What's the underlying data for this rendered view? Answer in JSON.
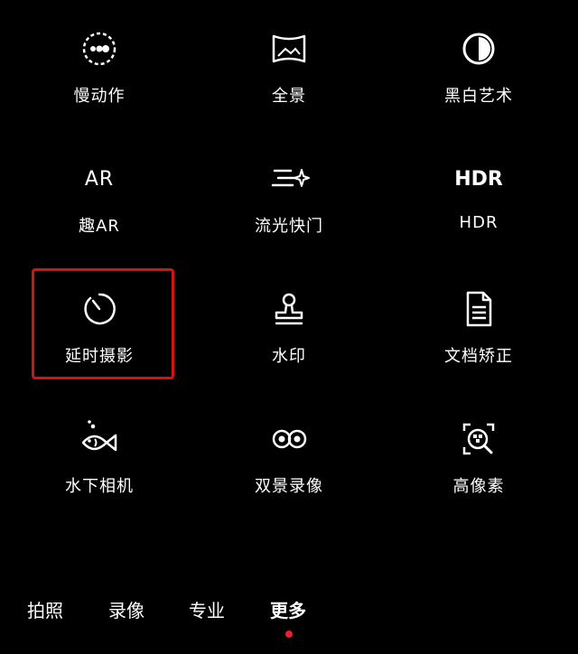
{
  "modes": [
    {
      "id": "slow-motion",
      "label": "慢动作",
      "icon": "slow-motion-icon"
    },
    {
      "id": "panorama",
      "label": "全景",
      "icon": "panorama-icon"
    },
    {
      "id": "bw-art",
      "label": "黑白艺术",
      "icon": "black-white-icon"
    },
    {
      "id": "fun-ar",
      "label": "趣AR",
      "icon": "ar-icon",
      "icon_text": "AR"
    },
    {
      "id": "light-trails",
      "label": "流光快门",
      "icon": "light-trails-icon"
    },
    {
      "id": "hdr",
      "label": "HDR",
      "icon": "hdr-icon",
      "icon_text": "HDR"
    },
    {
      "id": "time-lapse",
      "label": "延时摄影",
      "icon": "timer-icon",
      "highlighted": true
    },
    {
      "id": "watermark",
      "label": "水印",
      "icon": "stamp-icon"
    },
    {
      "id": "document",
      "label": "文档矫正",
      "icon": "document-icon"
    },
    {
      "id": "underwater",
      "label": "水下相机",
      "icon": "fish-icon"
    },
    {
      "id": "dual-view",
      "label": "双景录像",
      "icon": "dual-view-icon"
    },
    {
      "id": "high-res",
      "label": "高像素",
      "icon": "high-res-icon"
    }
  ],
  "tabs": [
    {
      "id": "photo",
      "label": "拍照"
    },
    {
      "id": "video",
      "label": "录像"
    },
    {
      "id": "pro",
      "label": "专业"
    },
    {
      "id": "more",
      "label": "更多",
      "active": true
    }
  ],
  "colors": {
    "background": "#000000",
    "text": "#ffffff",
    "highlight": "#d41414",
    "active_dot": "#e8202a"
  }
}
